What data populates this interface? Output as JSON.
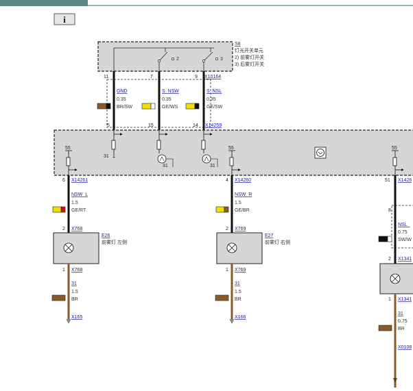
{
  "toolbar": {
    "info_icon": "info-icon",
    "info_glyph": "i"
  },
  "colors": {
    "header_bar": "#5a8a82",
    "link": "#1a1aa6",
    "module_fill": "#d6d6d6",
    "wire_brown": "#8b5a2b",
    "wire_yellow": "#f0e000",
    "wire_red": "#cc1010",
    "wire_black": "#111111",
    "wire_white": "#ffffff"
  },
  "switch_unit": {
    "id": "S8",
    "title_cn": "灯光开关单元",
    "legend": [
      "2)  前雾灯开关",
      "3)  后雾灯开关"
    ],
    "switch_labels": [
      "2",
      "3"
    ],
    "connector": "X10164",
    "pins": [
      "11",
      "7",
      "9"
    ]
  },
  "wires_top": [
    {
      "signal": "GND",
      "gauge": "0.35",
      "color_code": "BR/SW"
    },
    {
      "signal": "S_NSW",
      "gauge": "0.35",
      "color_code": "GE/WS"
    },
    {
      "signal": "S_NSL",
      "gauge": "0.35",
      "color_code": "GE/SW"
    }
  ],
  "control_module": {
    "top_connector": "X14259",
    "top_pins": [
      "5",
      "15",
      "14"
    ],
    "labels_31": [
      "31",
      "31",
      "31"
    ],
    "labels_55": [
      "55",
      "55",
      "55"
    ],
    "left_connector": "X14261",
    "left_pin": "6",
    "mid_connector": "X14260",
    "mid_pin": "4",
    "right_connector": "X1426",
    "right_pin": "51"
  },
  "left_chain": {
    "wire1": {
      "signal": "NSW_L",
      "gauge": "1.5",
      "color_code": "GE/RT"
    },
    "lamp": {
      "id": "E26",
      "desc_cn": "前雾灯 左侧",
      "connector_top": "X768",
      "pin_top": "2",
      "connector_bottom": "X768",
      "pin_bottom": "1"
    },
    "wire2": {
      "signal": "31",
      "gauge": "1.5",
      "color_code": "BR"
    },
    "ground": "X165"
  },
  "mid_chain": {
    "wire1": {
      "signal": "NSW_R",
      "gauge": "1.5",
      "color_code": "GE/BR"
    },
    "lamp": {
      "id": "E27",
      "desc_cn": "前雾灯 右侧",
      "connector_top": "X769",
      "pin_top": "2",
      "connector_bottom": "X769",
      "pin_bottom": "1"
    },
    "wire2": {
      "signal": "31",
      "gauge": "1.5",
      "color_code": "BR"
    },
    "ground": "X166"
  },
  "right_chain": {
    "pin_8": "8",
    "wire1": {
      "signal": "NSL_",
      "gauge": "0.75",
      "color_code": "SW/W"
    },
    "lamp": {
      "connector_top": "X1341",
      "pin_top": "2",
      "connector_bottom": "X1341",
      "pin_bottom": "1"
    },
    "wire2": {
      "signal": "31",
      "gauge": "0.75",
      "color_code": "BR"
    },
    "ground": "X0108"
  }
}
